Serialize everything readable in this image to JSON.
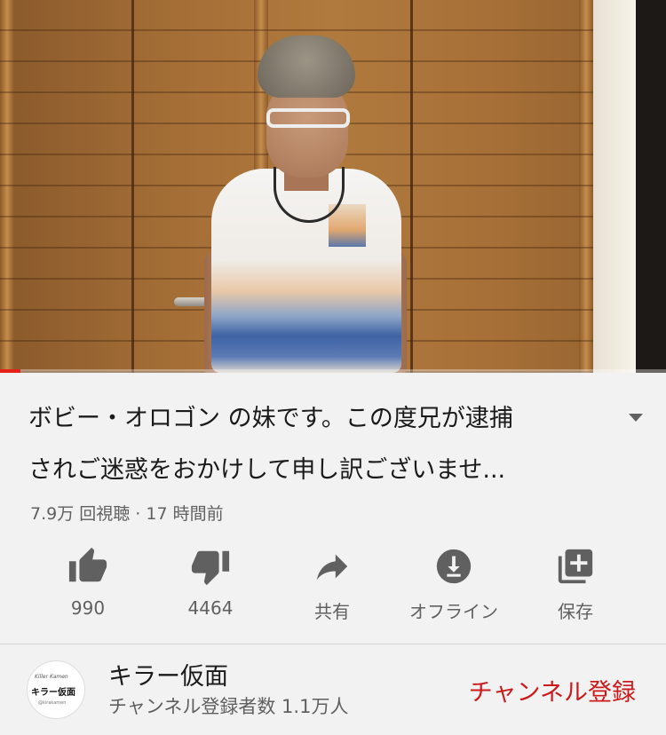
{
  "video": {
    "progress_fraction": 0.03,
    "progress_color": "#e62117"
  },
  "title": {
    "line1": "ボビー・オロゴン の妹です。この度兄が逮捕",
    "line2": "されご迷惑をおかけして申し訳ございませ..."
  },
  "meta": "7.9万 回視聴 · 17 時間前",
  "actions": {
    "like": {
      "icon": "thumbs-up-icon",
      "label": "990"
    },
    "dislike": {
      "icon": "thumbs-down-icon",
      "label": "4464"
    },
    "share": {
      "icon": "share-arrow-icon",
      "label": "共有"
    },
    "offline": {
      "icon": "download-icon",
      "label": "オフライン"
    },
    "save": {
      "icon": "add-to-playlist-icon",
      "label": "保存"
    }
  },
  "channel": {
    "avatar_text": "キラー仮面",
    "name": "キラー仮面",
    "subscribers": "チャンネル登録者数 1.1万人",
    "subscribe_label": "チャンネル登録",
    "subscribe_color": "#cc1a1a"
  }
}
